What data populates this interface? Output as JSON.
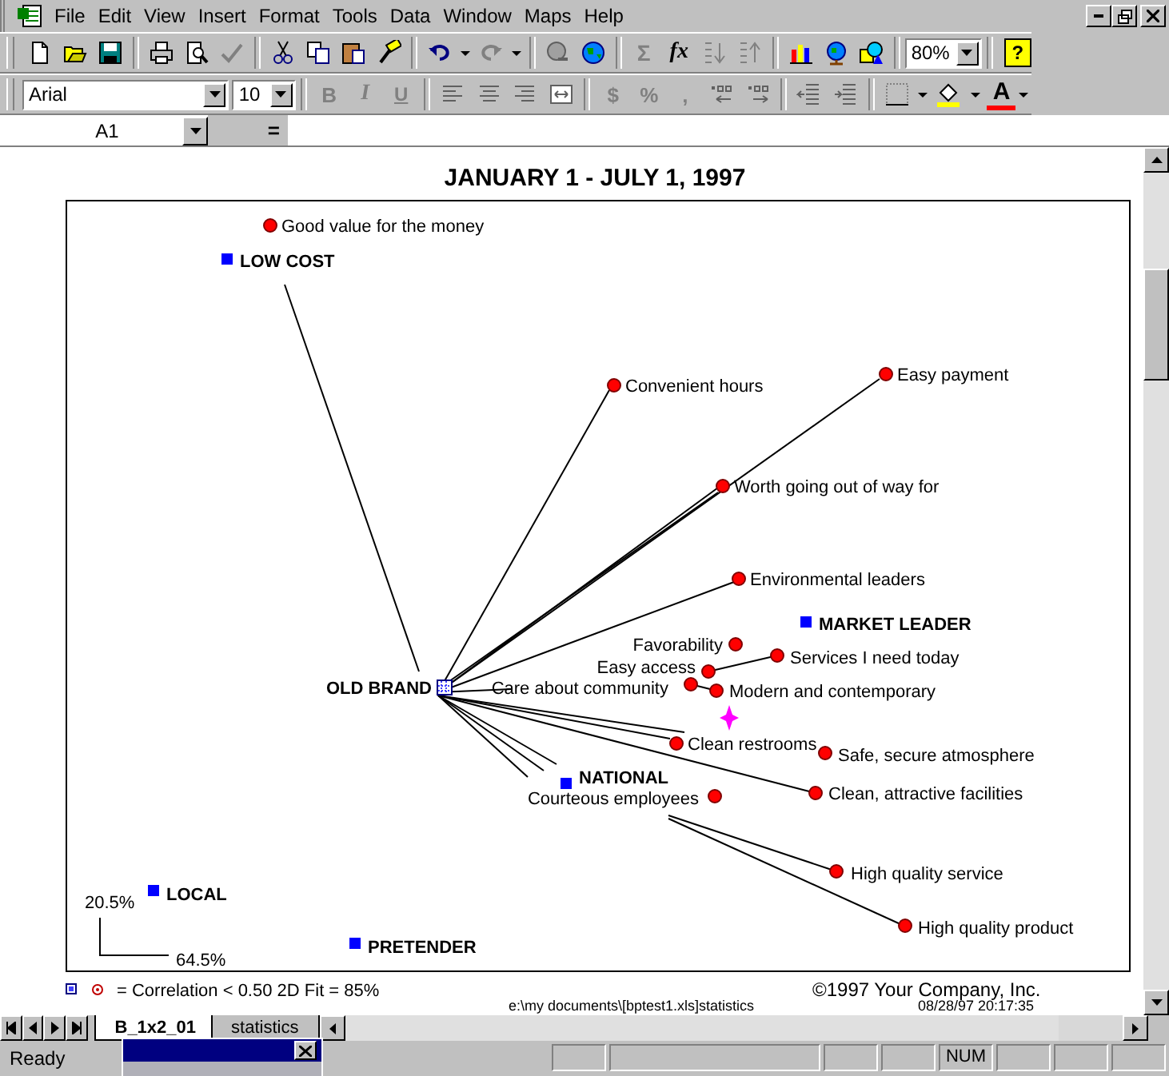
{
  "menu": [
    "File",
    "Edit",
    "View",
    "Insert",
    "Format",
    "Tools",
    "Data",
    "Window",
    "Maps",
    "Help"
  ],
  "standard_toolbar": {
    "autosum": "Σ",
    "function": "fx",
    "zoom": "80%",
    "help": "?"
  },
  "formatting_toolbar": {
    "font": "Arial",
    "size": "10",
    "bold": "B",
    "italic": "I",
    "underline": "U",
    "currency": "$",
    "percent": "%",
    "comma": ",",
    "font_color": "A"
  },
  "formula_bar": {
    "name_box": "A1",
    "equals": "="
  },
  "chart": {
    "subtitle": "JANUARY 1 - JULY 1, 1997",
    "points": [
      {
        "kind": "attribute",
        "label": "Good value for the money"
      },
      {
        "kind": "brand",
        "label": "LOW COST"
      },
      {
        "kind": "attribute",
        "label": "Convenient hours"
      },
      {
        "kind": "attribute",
        "label": "Easy payment"
      },
      {
        "kind": "attribute",
        "label": "Worth going out of way for"
      },
      {
        "kind": "attribute",
        "label": "Environmental leaders"
      },
      {
        "kind": "brand",
        "label": "MARKET LEADER"
      },
      {
        "kind": "attribute",
        "label": "Favorability"
      },
      {
        "kind": "attribute",
        "label": "Easy access"
      },
      {
        "kind": "attribute",
        "label": "Services I need today"
      },
      {
        "kind": "current",
        "label": "OLD BRAND"
      },
      {
        "kind": "attribute",
        "label": "Care about community"
      },
      {
        "kind": "attribute",
        "label": "Modern and contemporary"
      },
      {
        "kind": "ideal"
      },
      {
        "kind": "attribute",
        "label": "Clean restrooms"
      },
      {
        "kind": "attribute",
        "label": "Safe, secure atmosphere"
      },
      {
        "kind": "brand",
        "label": "NATIONAL"
      },
      {
        "kind": "attribute",
        "label": "Courteous employees"
      },
      {
        "kind": "attribute",
        "label": "Clean, attractive facilities"
      },
      {
        "kind": "attribute",
        "label": "High quality service"
      },
      {
        "kind": "brand",
        "label": "LOCAL"
      },
      {
        "kind": "attribute",
        "label": "High quality product"
      },
      {
        "kind": "brand",
        "label": "PRETENDER"
      }
    ],
    "scale": {
      "vertical": "20.5%",
      "horizontal": "64.5%"
    },
    "legend": "= Correlation < 0.50  2D Fit = 85%",
    "copyright": "©1997 Your Company, Inc.",
    "path": "e:\\my documents\\[bptest1.xls]statistics",
    "timestamp": "08/28/97 20:17:35"
  },
  "sheet_tabs": [
    {
      "label": "B_1x2_01",
      "selected": true
    },
    {
      "label": "statistics",
      "selected": false
    }
  ],
  "status_bar": {
    "mode": "Ready",
    "num": "NUM"
  }
}
